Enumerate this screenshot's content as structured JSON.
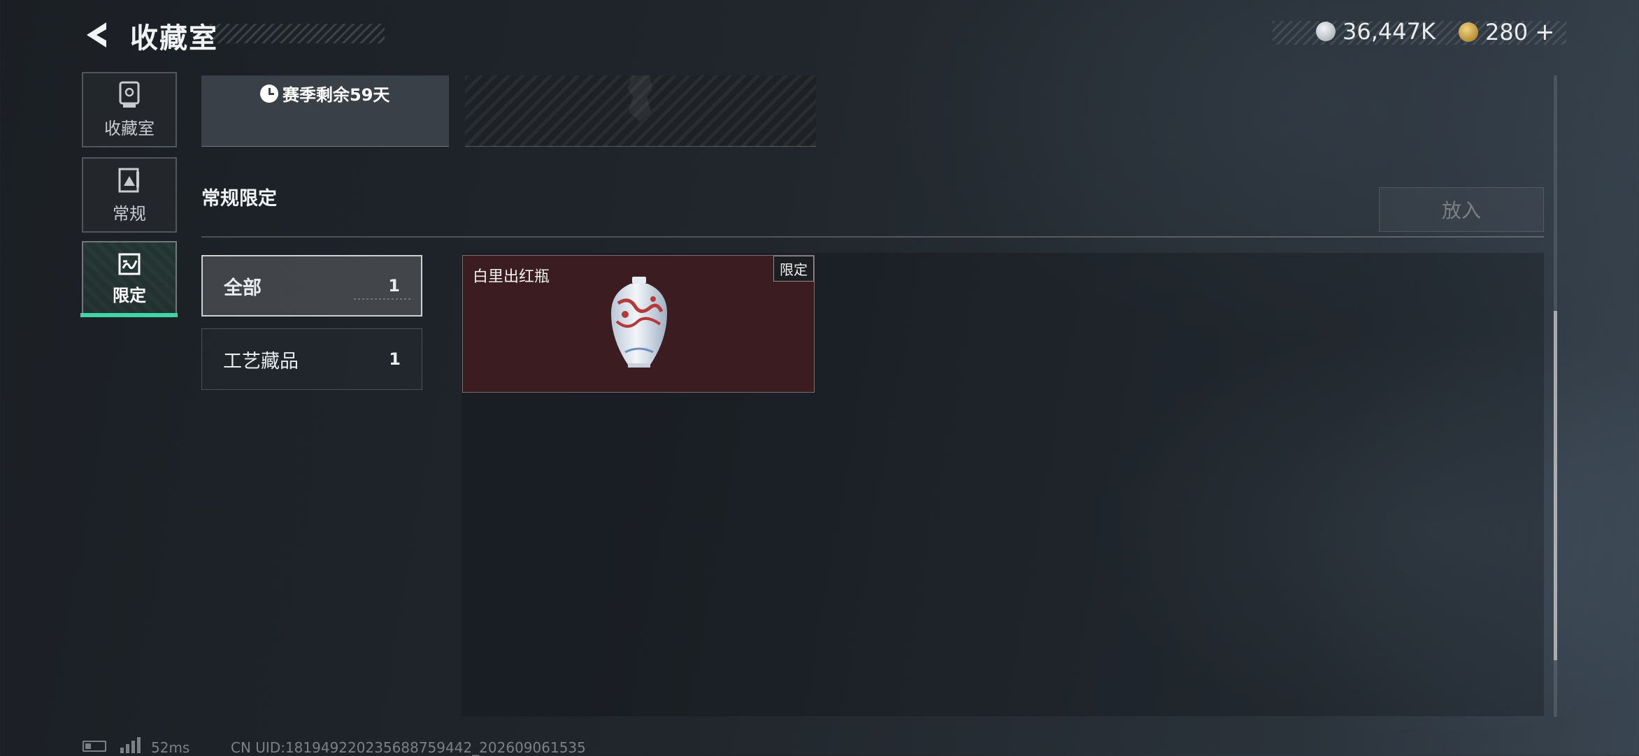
{
  "header": {
    "title": "收藏室",
    "currency_silver": "36,447K",
    "currency_gold": "280",
    "currency_add": "+",
    "colors": {
      "silver_icon": "#c9ced3",
      "gold_icon": "#c9a13c"
    }
  },
  "sidebar": {
    "items": [
      {
        "label": "收藏室",
        "icon": "trophy-icon"
      },
      {
        "label": "常规",
        "icon": "card-icon"
      },
      {
        "label": "限定",
        "icon": "limited-icon",
        "active": true
      }
    ],
    "active_color": "#3fd6a6"
  },
  "season": {
    "remaining_text": "赛季剩余59天"
  },
  "section": {
    "heading": "常规限定",
    "put_in_label": "放入"
  },
  "filters": [
    {
      "label": "全部",
      "count": "1",
      "selected": true
    },
    {
      "label": "工艺藏品",
      "count": "1",
      "selected": false
    }
  ],
  "items": [
    {
      "name": "白里出红瓶",
      "badge": "限定",
      "card_color": "#3b1d21"
    }
  ],
  "footer": {
    "ping": "52ms",
    "uid": "CN UID:18194922023568875944​2_202609061535"
  }
}
